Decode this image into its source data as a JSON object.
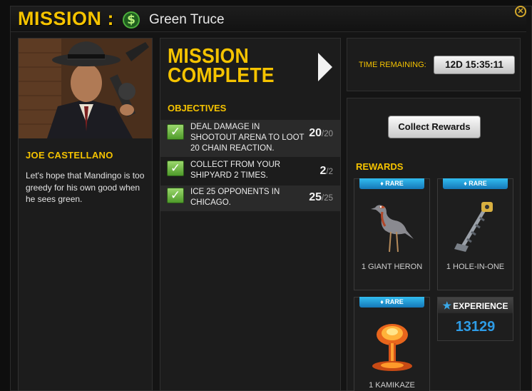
{
  "header": {
    "label": "MISSION :",
    "money_icon_glyph": "$",
    "mission_name": "Green Truce",
    "close_glyph": "✕"
  },
  "character": {
    "name": "JOE CASTELLANO",
    "quote": "Let's hope that Mandingo is too greedy for his own good when he sees green."
  },
  "mission": {
    "status_title": "MISSION COMPLETE",
    "objectives_label": "OBJECTIVES",
    "objectives": [
      {
        "text": "DEAL DAMAGE IN SHOOTOUT ARENA TO LOOT 20 CHAIN REACTION.",
        "done": 20,
        "total": "/20",
        "complete": true
      },
      {
        "text": "COLLECT FROM YOUR SHIPYARD 2 TIMES.",
        "done": 2,
        "total": "/2",
        "complete": true
      },
      {
        "text": "ICE 25 OPPONENTS IN CHICAGO.",
        "done": 25,
        "total": "/25",
        "complete": true
      }
    ]
  },
  "timer": {
    "label": "TIME REMAINING:",
    "value": "12D 15:35:11"
  },
  "rewards": {
    "collect_button": "Collect Rewards",
    "label": "REWARDS",
    "rarity_label": "♦ RARE",
    "items": [
      {
        "name": "1 GIANT HERON",
        "rarity": "RARE",
        "icon": "heron-icon"
      },
      {
        "name": "1 HOLE-IN-ONE",
        "rarity": "RARE",
        "icon": "golf-club-gun-icon"
      },
      {
        "name": "1 KAMIKAZE",
        "rarity": "RARE",
        "icon": "mushroom-cloud-icon"
      }
    ],
    "experience": {
      "label": "EXPERIENCE",
      "value": "13129"
    }
  },
  "colors": {
    "accent_gold": "#f5c300",
    "rare_blue": "#1f9ad8",
    "check_green": "#5cb335",
    "exp_blue": "#2e9ce6"
  }
}
